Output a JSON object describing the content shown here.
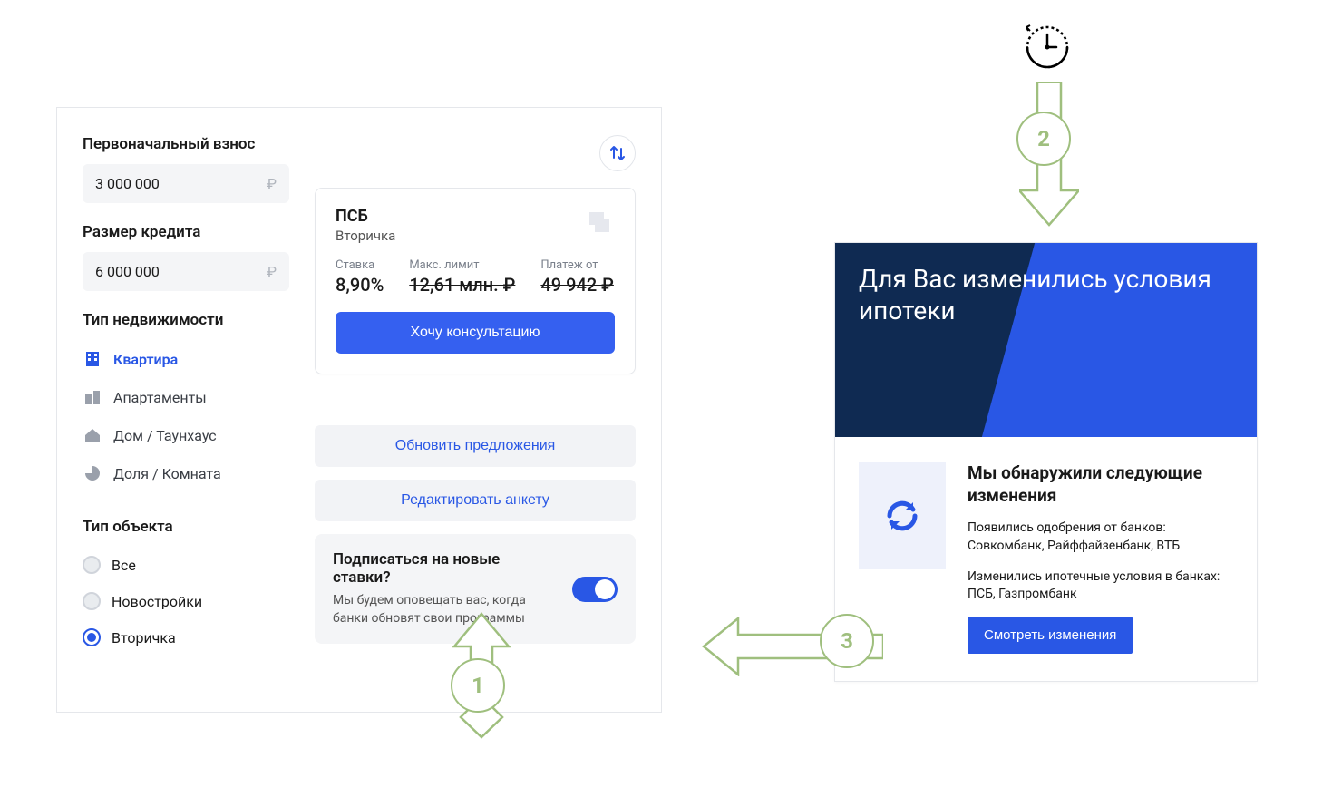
{
  "filters": {
    "initial_payment_label": "Первоначальный взнос",
    "initial_payment_value": "3 000 000",
    "credit_size_label": "Размер кредита",
    "credit_size_value": "6 000 000",
    "ruble_sign": "₽",
    "property_type_label": "Тип недвижимости",
    "property_types": {
      "apartment": "Квартира",
      "apartments": "Апартаменты",
      "house": "Дом / Таунхаус",
      "share": "Доля / Комната"
    },
    "object_type_label": "Тип объекта",
    "object_types": {
      "all": "Все",
      "new": "Новостройки",
      "secondary": "Вторичка"
    }
  },
  "offer": {
    "bank": "ПСБ",
    "program": "Вторичка",
    "rate_label": "Ставка",
    "rate_value": "8,90%",
    "limit_label": "Макс. лимит",
    "limit_value": "12,61 млн. ₽",
    "payment_label": "Платеж от",
    "payment_value": "49 942 ₽",
    "cta": "Хочу консультацию"
  },
  "actions": {
    "refresh_offers": "Обновить предложения",
    "edit_form": "Редактировать анкету"
  },
  "subscribe": {
    "title": "Подписаться на новые ставки?",
    "desc": "Мы будем оповещать вас, когда банки обновят свои программы"
  },
  "email": {
    "title": "Для Вас изменились условия ипотеки",
    "subtitle": "Мы обнаружили следующие изменения",
    "p1": "Появились одобрения от банков: Совкомбанк, Райффайзенбанк, ВТБ",
    "p2": "Изменились ипотечные условия в банках: ПСБ, Газпромбанк",
    "button": "Смотреть изменения"
  },
  "flow": {
    "step1": "1",
    "step2": "2",
    "step3": "3"
  }
}
